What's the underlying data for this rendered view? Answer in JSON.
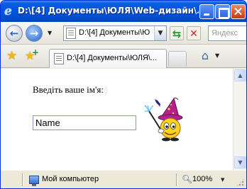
{
  "window": {
    "title": "D:\\[4] Документы\\ЮЛЯ\\Web-дизайн\\Лабор…"
  },
  "navbar": {
    "address": "D:\\[4] Документы\\Ю",
    "search_placeholder": "Яндекс"
  },
  "tabs": [
    {
      "label": "D:\\[4] Документы\\ЮЛЯ\\..."
    }
  ],
  "content": {
    "prompt": "Введіть ваше ім'я:",
    "name_value": "Name"
  },
  "statusbar": {
    "zone": "Мой компьютер",
    "zoom": "100%"
  },
  "colors": {
    "titlebar": "#0055e5",
    "window_frame": "#ece9d8",
    "refresh": "#1f9a2e",
    "stop": "#d8261e"
  }
}
